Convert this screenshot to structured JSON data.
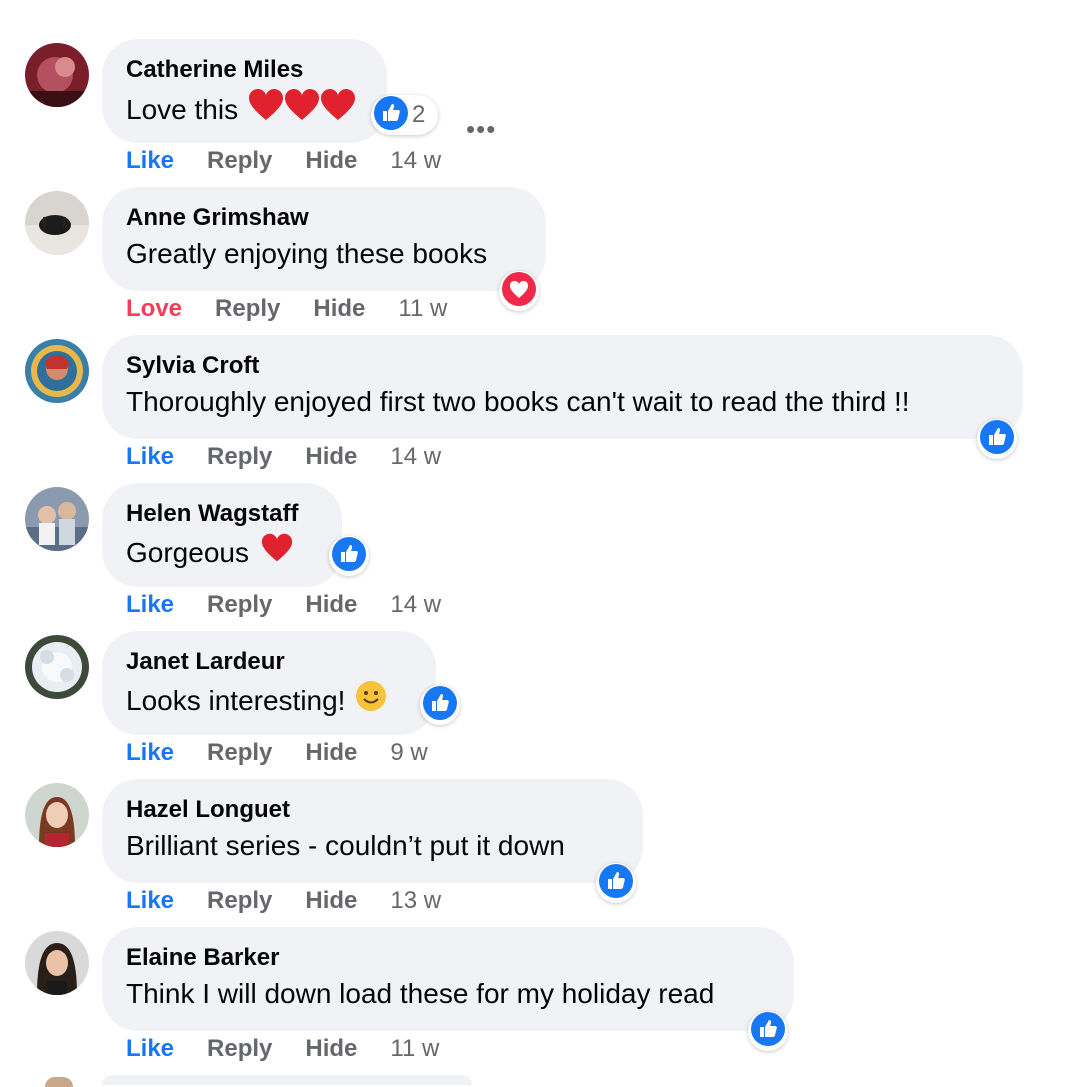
{
  "actions": {
    "like": "Like",
    "love": "Love",
    "reply": "Reply",
    "hide": "Hide"
  },
  "colors": {
    "bubble": "#f0f2f5",
    "like_blue": "#1877f2",
    "love_red": "#f33e58",
    "meta_grey": "#65676b"
  },
  "comments": [
    {
      "author": "Catherine Miles",
      "text": "Love this",
      "emojis": [
        "red-heart-icon",
        "red-heart-icon",
        "red-heart-icon"
      ],
      "reaction": "like",
      "reaction_count": "2",
      "my_reaction": "Like",
      "time": "14 w",
      "has_more_menu": true
    },
    {
      "author": "Anne Grimshaw",
      "text": "Greatly enjoying these books",
      "emojis": [],
      "reaction": "love",
      "my_reaction": "Love",
      "time": "11 w"
    },
    {
      "author": "Sylvia Croft",
      "text": "Thoroughly enjoyed first two books can't wait to read the third !!",
      "emojis": [],
      "reaction": "like",
      "my_reaction": "Like",
      "time": "14 w"
    },
    {
      "author": "Helen Wagstaff",
      "text": "Gorgeous",
      "emojis": [
        "red-heart-icon"
      ],
      "reaction": "like",
      "my_reaction": "Like",
      "time": "14 w"
    },
    {
      "author": "Janet Lardeur",
      "text": "Looks interesting!",
      "emojis": [
        "smiley-face-icon"
      ],
      "reaction": "like",
      "my_reaction": "Like",
      "time": "9 w"
    },
    {
      "author": "Hazel Longuet",
      "text": "Brilliant series - couldn’t put it down",
      "emojis": [],
      "reaction": "like",
      "my_reaction": "Like",
      "time": "13 w"
    },
    {
      "author": "Elaine Barker",
      "text": "Think I will down load these for my holiday read",
      "emojis": [],
      "reaction": "like",
      "my_reaction": "Like",
      "time": "11 w"
    }
  ]
}
